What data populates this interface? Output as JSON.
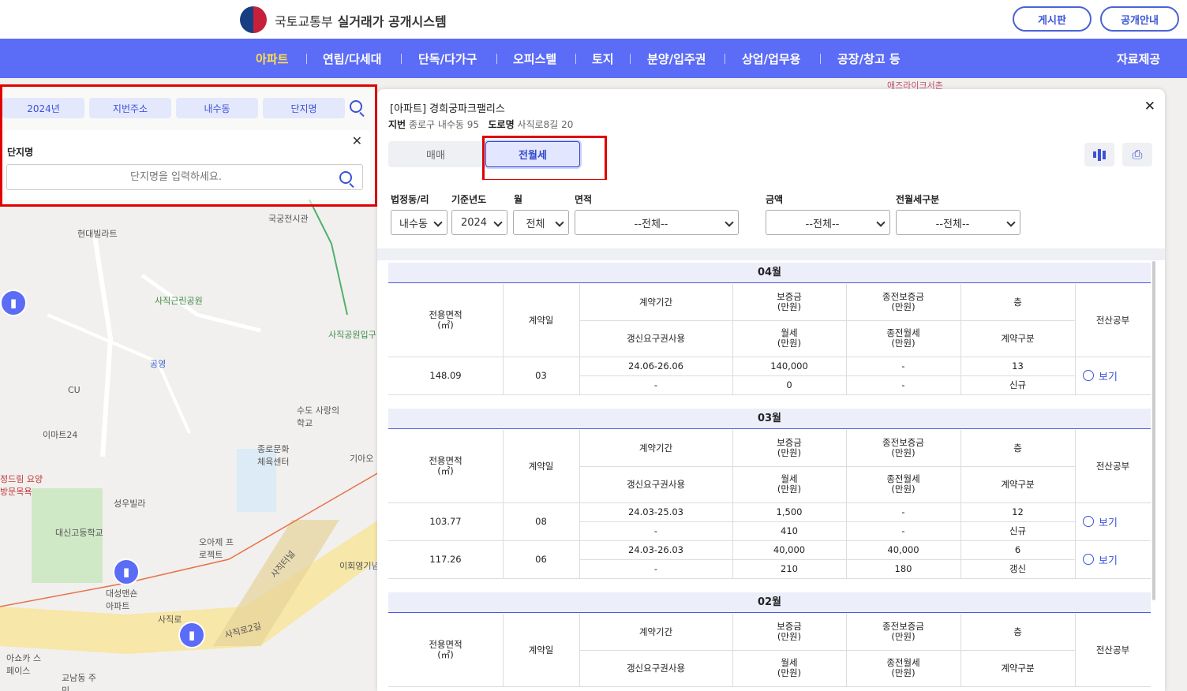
{
  "header": {
    "ministry": "국토교통부",
    "system": "실거래가 공개시스템",
    "board_btn": "게시판",
    "info_btn": "공개안내"
  },
  "nav": {
    "items": [
      "아파트",
      "연립/다세대",
      "단독/다가구",
      "오피스텔",
      "토지",
      "분양/입주권",
      "상업/업무용",
      "공장/창고 등"
    ],
    "active": "아파트",
    "data_provide": "자료제공"
  },
  "search": {
    "chips": [
      "2024년",
      "지번주소",
      "내수동",
      "단지명"
    ],
    "panel_title": "단지명",
    "placeholder": "단지명을 입력하세요."
  },
  "map_labels": [
    "현대빌라트",
    "사직근린공원",
    "공영",
    "CU",
    "이마트24",
    "성우빌라",
    "대신고등학교",
    "오아제 프로젝트",
    "대성맨숀 아파트",
    "아쇼카 스페이스",
    "교남동 주민",
    "수도 사랑의학교",
    "종로문화 체육센터",
    "국궁전시관",
    "사직공원입구",
    "사직터널",
    "사직로",
    "사직로2길",
    "이회영기념",
    "기아오",
    "정드림 요양방문목욕",
    "애즈라이크서촌"
  ],
  "detail": {
    "title": "[아파트] 경희궁파크팰리스",
    "jibun_label": "지번",
    "jibun_value": "종로구 내수동 95",
    "road_label": "도로명",
    "road_value": "사직로8길 20",
    "tab_sale": "매매",
    "tab_rent": "전월세",
    "active_tab": "전월세",
    "filters": {
      "labels": [
        "법정동/리",
        "기준년도",
        "월",
        "면적",
        "금액",
        "전월세구분"
      ],
      "values": [
        "내수동",
        "2024",
        "전체",
        "--전체--",
        "--전체--",
        "--전체--"
      ]
    }
  },
  "table_headers": {
    "area": "전용면적\n(㎡)",
    "day": "계약일",
    "period": "계약기간",
    "renew": "갱신요구권사용",
    "deposit": "보증금\n(만원)",
    "monthly": "월세\n(만원)",
    "prev_deposit": "종전보증금\n(만원)",
    "prev_monthly": "종전월세\n(만원)",
    "floor": "층",
    "contract_type": "계약구분",
    "registry": "전산공부",
    "view": "보기"
  },
  "months": [
    {
      "month": "04월",
      "rows": [
        {
          "area": "148.09",
          "day": "03",
          "period": "24.06-26.06",
          "renew": "-",
          "deposit": "140,000",
          "monthly": "0",
          "prev_deposit": "-",
          "prev_monthly": "-",
          "floor": "13",
          "type": "신규"
        }
      ]
    },
    {
      "month": "03월",
      "rows": [
        {
          "area": "103.77",
          "day": "08",
          "period": "24.03-25.03",
          "renew": "-",
          "deposit": "1,500",
          "monthly": "410",
          "prev_deposit": "-",
          "prev_monthly": "-",
          "floor": "12",
          "type": "신규"
        },
        {
          "area": "117.26",
          "day": "06",
          "period": "24.03-26.03",
          "renew": "-",
          "deposit": "40,000",
          "monthly": "210",
          "prev_deposit": "40,000",
          "prev_monthly": "180",
          "floor": "6",
          "type": "갱신"
        }
      ]
    },
    {
      "month": "02월",
      "rows": []
    }
  ]
}
